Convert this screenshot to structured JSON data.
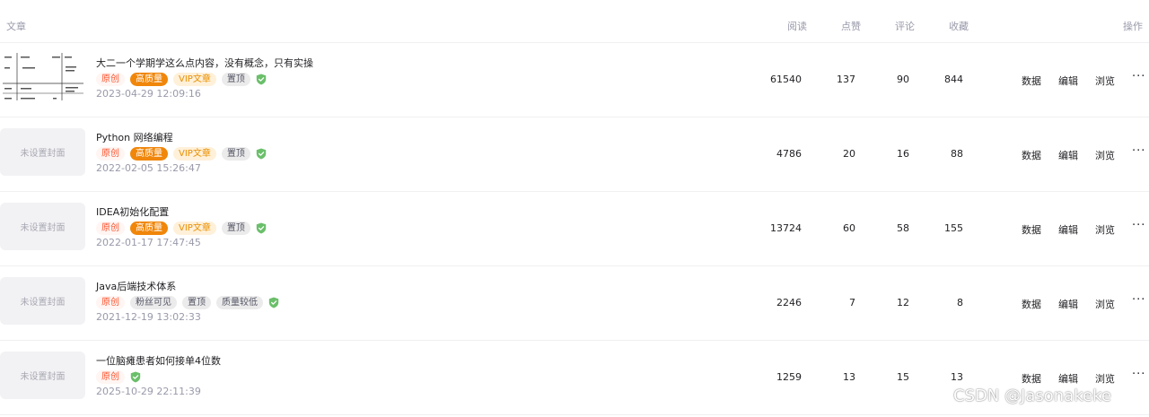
{
  "header": {
    "title": "文章",
    "read": "阅读",
    "like": "点赞",
    "comment": "评论",
    "favorite": "收藏",
    "actions": "操作"
  },
  "articles": [
    {
      "cover_text": "",
      "title": "大二一个学期学这么点内容，没有概念，只有实操",
      "tags": [
        "原创",
        "高质量",
        "VIP文章",
        "置顶"
      ],
      "date": "2023-04-29 12:09:16",
      "read": "61540",
      "like": "137",
      "comment": "90",
      "favorite": "844"
    },
    {
      "cover_text": "未设置封面",
      "title": "Python 网络编程",
      "tags": [
        "原创",
        "高质量",
        "VIP文章",
        "置顶"
      ],
      "date": "2022-02-05 15:26:47",
      "read": "4786",
      "like": "20",
      "comment": "16",
      "favorite": "88"
    },
    {
      "cover_text": "未设置封面",
      "title": "IDEA初始化配置",
      "tags": [
        "原创",
        "高质量",
        "VIP文章",
        "置顶"
      ],
      "date": "2022-01-17 17:47:45",
      "read": "13724",
      "like": "60",
      "comment": "58",
      "favorite": "155"
    },
    {
      "cover_text": "未设置封面",
      "title": "Java后端技术体系",
      "tags": [
        "原创",
        "粉丝可见",
        "置顶",
        "质量较低"
      ],
      "date": "2021-12-19 13:02:33",
      "read": "2246",
      "like": "7",
      "comment": "12",
      "favorite": "8"
    },
    {
      "cover_text": "未设置封面",
      "title": "一位脑瘫患者如何接单4位数",
      "tags": [
        "原创"
      ],
      "date": "2025-10-29 22:11:39",
      "read": "1259",
      "like": "13",
      "comment": "15",
      "favorite": "13"
    }
  ],
  "row_actions": {
    "data": "数据",
    "edit": "编辑",
    "view": "浏览",
    "more": "···"
  },
  "watermark": "CSDN @Jasonakeke",
  "colors": {
    "original": "#fc5531",
    "high_quality": "#f0860a",
    "vip": "#e88f00",
    "verified": "#6bbf6b"
  },
  "icons": {
    "verified": "shield-check-icon",
    "more": "more-icon"
  }
}
